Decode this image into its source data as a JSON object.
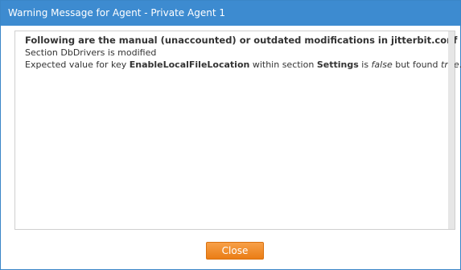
{
  "dialog": {
    "title": "Warning Message for Agent - Private Agent 1",
    "heading": "Following are the manual (unaccounted) or outdated modifications in jitterbit.conf :",
    "line1": "Section DbDrivers is modified",
    "line2": {
      "prefix": "Expected value for key ",
      "key": "EnableLocalFileLocation",
      "mid1": " within section ",
      "section": "Settings",
      "mid2": " is ",
      "expected": "false",
      "mid3": " but found ",
      "found": "true",
      "suffix": "."
    },
    "close_label": "Close"
  },
  "colors": {
    "titlebar": "#3d8bd0",
    "button": "#ef8a22"
  }
}
